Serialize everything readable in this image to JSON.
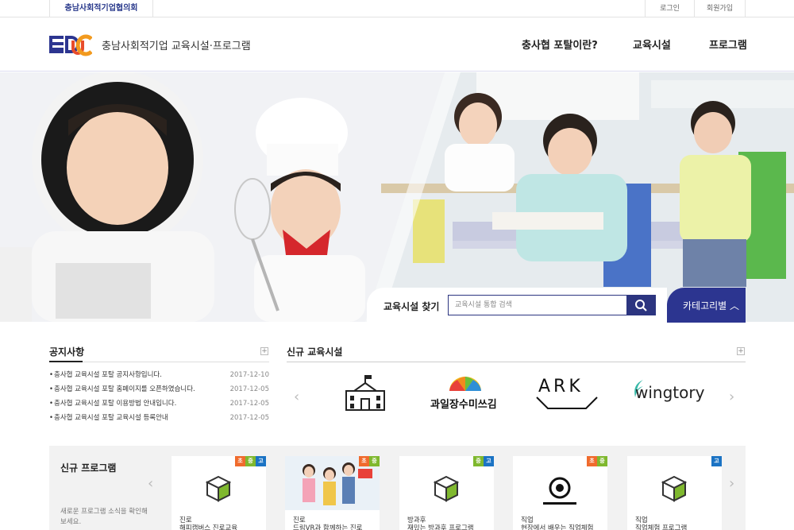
{
  "topbar": {
    "org_name": "충남사회적기업협의회",
    "login": "로그인",
    "join": "회원가입"
  },
  "header": {
    "logo_text": "EDUC",
    "site_title": "충남사회적기업 교육시설·프로그램",
    "nav": [
      "충사협 포탈이란?",
      "교육시설",
      "프로그램"
    ]
  },
  "search": {
    "label": "교육시설 찾기",
    "placeholder": "교육시설 통합 검색",
    "category_button": "카테고리별 ︿"
  },
  "notice": {
    "title": "공지사항",
    "items": [
      {
        "text": "충사협 교육시설 포탈 공지사항입니다.",
        "date": "2017-12-10"
      },
      {
        "text": "충사협 교육시설 포탈 홈페이지를 오픈하였습니다.",
        "date": "2017-12-05"
      },
      {
        "text": "충사협 교육시설 포탈 이용방법 안내입니다.",
        "date": "2017-12-05"
      },
      {
        "text": "충사협 교육시설 포탈 교육시설 등록안내",
        "date": "2017-12-05"
      }
    ]
  },
  "facilities": {
    "title": "신규 교육시설",
    "logos": [
      "school-building-logo",
      "과일장수미쓰김",
      "ARK",
      "wingtory"
    ]
  },
  "programs": {
    "title": "신규 프로그램",
    "desc": "새로운 프로그램 소식을 확인해보세요.",
    "cards": [
      {
        "badges": [
          "초",
          "중",
          "고"
        ],
        "category": "진로",
        "name": "해피캠버스 진로교육",
        "image": "cube-icon"
      },
      {
        "badges": [
          "초",
          "중"
        ],
        "category": "진로",
        "name": "드림VR과 함께하는 진로",
        "image": "kids-photo"
      },
      {
        "badges": [
          "중",
          "고"
        ],
        "category": "방과후",
        "name": "재밌는 방과후 프로그램",
        "image": "cube-icon"
      },
      {
        "badges": [
          "초",
          "중"
        ],
        "category": "직업",
        "name": "현장에서 배우는 직업체험",
        "image": "mediatelling-logo"
      },
      {
        "badges": [
          "고"
        ],
        "category": "직업",
        "name": "직업체험 프로그램",
        "image": "cube-icon"
      }
    ]
  },
  "colors": {
    "primary": "#2c3580",
    "badge_elementary": "#f06b2d",
    "badge_middle": "#7fb82e",
    "badge_high": "#1b73c4"
  }
}
